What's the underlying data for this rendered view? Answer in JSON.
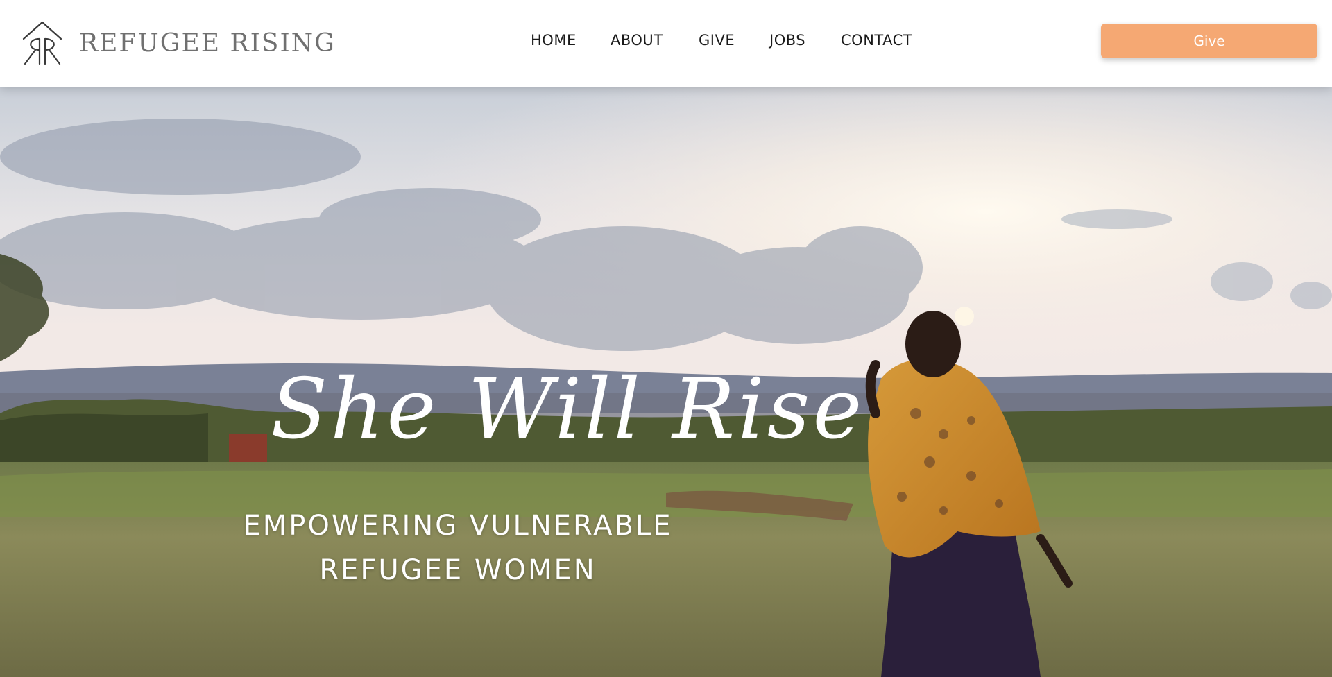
{
  "brand": {
    "name": "REFUGEE RISING",
    "logo_icon": "rr-monogram-icon"
  },
  "nav": {
    "items": [
      {
        "label": "HOME"
      },
      {
        "label": "ABOUT"
      },
      {
        "label": "GIVE"
      },
      {
        "label": "JOBS"
      },
      {
        "label": "CONTACT"
      }
    ]
  },
  "header": {
    "give_button_label": "Give"
  },
  "hero": {
    "script_heading": "She Will Rise",
    "tagline_line1": "EMPOWERING VULNERABLE",
    "tagline_line2": "REFUGEE WOMEN",
    "image_description_icon": "woman-in-field-photo"
  },
  "colors": {
    "accent": "#f5a873",
    "logo_gray": "#707070",
    "nav_text": "#1a1a1a"
  }
}
